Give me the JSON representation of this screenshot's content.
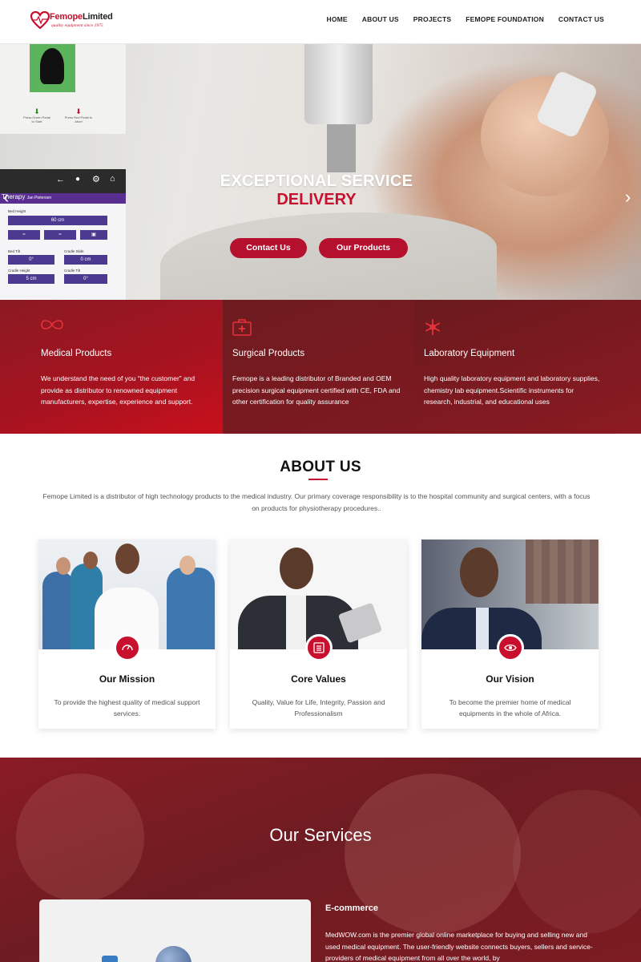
{
  "brand": {
    "name_part1": "Femope",
    "name_part2": "Limited",
    "tagline": "quality equipment since 1975",
    "accent_color": "#c8102e"
  },
  "nav": {
    "items": [
      "HOME",
      "ABOUT US",
      "PROJECTS",
      "FEMOPE FOUNDATION",
      "CONTACT US"
    ]
  },
  "hero": {
    "title_line1": "EXCEPTIONAL SERVICE",
    "title_line2": "DELIVERY",
    "buttons": [
      "Contact Us",
      "Our Products"
    ],
    "prev_icon": "chevron-left-icon",
    "next_icon": "chevron-right-icon",
    "screen": {
      "therapy_label": "Therapy",
      "patient": "Jan Pietersen",
      "bed_height_label": "Bed Height",
      "bed_height_value": "60 cm",
      "bed_tilt_label": "Bed Tilt",
      "bed_tilt_value": "0°",
      "cradle_slide_label": "Cradle Slide",
      "cradle_slide_value": "0 cm",
      "cradle_height_label": "Cradle Height",
      "cradle_height_value": "5 cm",
      "cradle_tilt_label": "Cradle Tilt",
      "cradle_tilt_value": "0°",
      "pedal_green": "Press Green Pedal to Start",
      "pedal_red": "Press Red Pedal to Abort"
    }
  },
  "features": [
    {
      "icon": "infinity-icon",
      "title": "Medical Products",
      "text": "We understand the need of you “the customer” and provide as distributor to renowned equipment manufacturers, expertise, experience and support."
    },
    {
      "icon": "first-aid-kit-icon",
      "title": "Surgical Products",
      "text": "Femope is a leading distributor of Branded and OEM precision surgical equipment certified with CE, FDA and other certification for quality assurance"
    },
    {
      "icon": "asterisk-icon",
      "title": "Laboratory Equipment",
      "text": "High quality laboratory equipment and laboratory supplies, chemistry lab equipment.Scientific instruments for research, industrial, and educational uses"
    }
  ],
  "about": {
    "title": "ABOUT US",
    "text": "Femope Limited is a distributor of high technology products to the medical industry. Our primary coverage responsibility is to the hospital community and surgical centers, with a focus on products for physiotherapy procedures..",
    "cards": [
      {
        "icon": "speedometer-icon",
        "title": "Our Mission",
        "text": "To provide the highest quality of medical support services."
      },
      {
        "icon": "list-icon",
        "title": "Core Values",
        "text": "Quality, Value for Life, Integrity, Passion and Professionalism"
      },
      {
        "icon": "eye-icon",
        "title": "Our Vision",
        "text": "To become the premier home of medical equipments in the whole of Africa."
      }
    ]
  },
  "services": {
    "title": "Our Services",
    "item_title": "E-commerce",
    "item_text": "MedWOW.com is the premier global online marketplace for buying and selling new and used medical equipment. The user-friendly website connects buyers, sellers and service-providers of medical equipment from all over the world, by"
  }
}
